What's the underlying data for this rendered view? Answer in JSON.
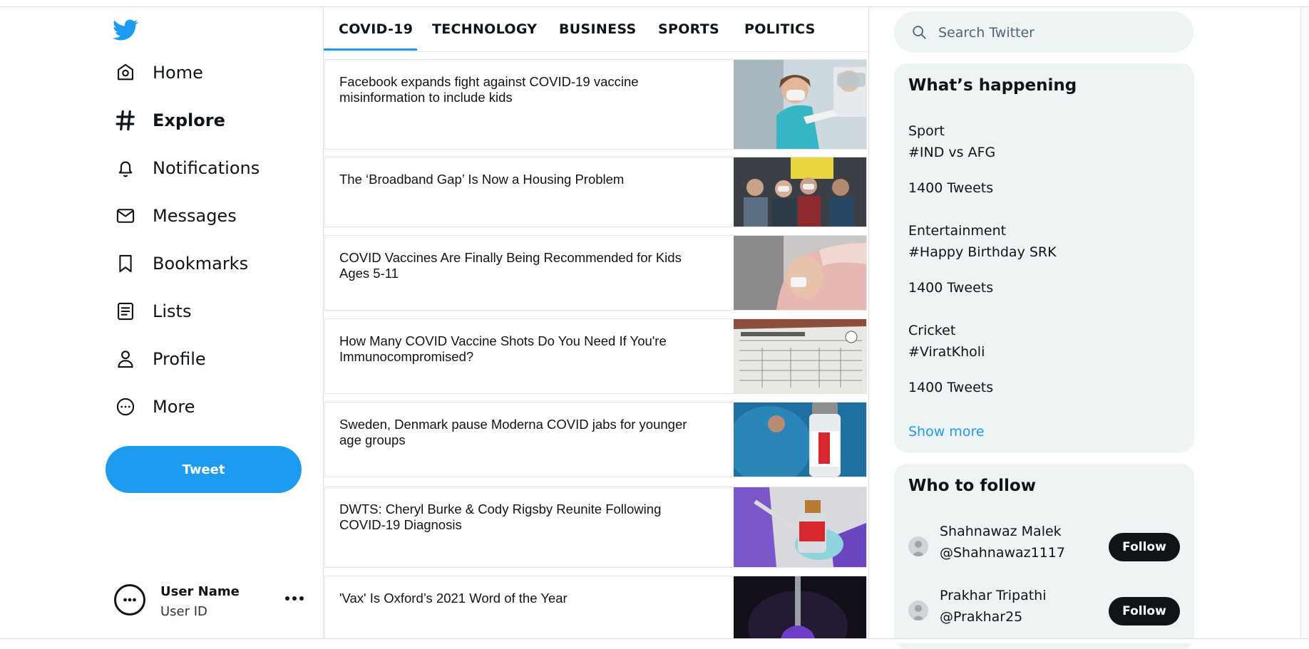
{
  "nav": {
    "items": [
      {
        "label": "Home",
        "icon": "home-icon"
      },
      {
        "label": "Explore",
        "icon": "hashtag-icon"
      },
      {
        "label": "Notifications",
        "icon": "bell-icon"
      },
      {
        "label": "Messages",
        "icon": "mail-icon"
      },
      {
        "label": "Bookmarks",
        "icon": "bookmark-icon"
      },
      {
        "label": "Lists",
        "icon": "list-icon"
      },
      {
        "label": "Profile",
        "icon": "person-icon"
      },
      {
        "label": "More",
        "icon": "more-circle-icon"
      }
    ],
    "active": "Explore",
    "tweet_label": "Tweet",
    "brand_color": "#1d9bf0"
  },
  "user": {
    "name": "User Name",
    "id": "User ID"
  },
  "tabs": {
    "items": [
      "COVID-19",
      "TECHNOLOGY",
      "BUSINESS",
      "SPORTS",
      "POLITICS"
    ],
    "active": "COVID-19"
  },
  "articles": [
    {
      "title": "Facebook expands fight against COVID-19 vaccine misinformation to include kids"
    },
    {
      "title": "The ‘Broadband Gap’ Is Now a Housing Problem"
    },
    {
      "title": "COVID Vaccines Are Finally Being Recommended for Kids Ages 5-11"
    },
    {
      "title": "How Many COVID Vaccine Shots Do You Need If You're Immunocompromised?"
    },
    {
      "title": "Sweden, Denmark pause Moderna COVID jabs for younger age groups"
    },
    {
      "title": "DWTS: Cheryl Burke & Cody Rigsby Reunite Following COVID-19 Diagnosis"
    },
    {
      "title": "'Vax' Is Oxford’s 2021 Word of the Year"
    }
  ],
  "search": {
    "placeholder": "Search Twitter"
  },
  "happening": {
    "title": "What’s happening",
    "trends": [
      {
        "category": "Sport",
        "tag": "#IND vs AFG",
        "count": "1400 Tweets"
      },
      {
        "category": "Entertainment",
        "tag": "#Happy Birthday SRK",
        "count": "1400 Tweets"
      },
      {
        "category": "Cricket",
        "tag": "#ViratKholi",
        "count": "1400 Tweets"
      }
    ],
    "show_more": "Show more"
  },
  "who_to_follow": {
    "title": "Who to follow",
    "people": [
      {
        "name": "Shahnawaz Malek",
        "handle": "@Shahnawaz1117",
        "button": "Follow"
      },
      {
        "name": "Prakhar Tripathi",
        "handle": "@Prakhar25",
        "button": "Follow"
      }
    ]
  }
}
